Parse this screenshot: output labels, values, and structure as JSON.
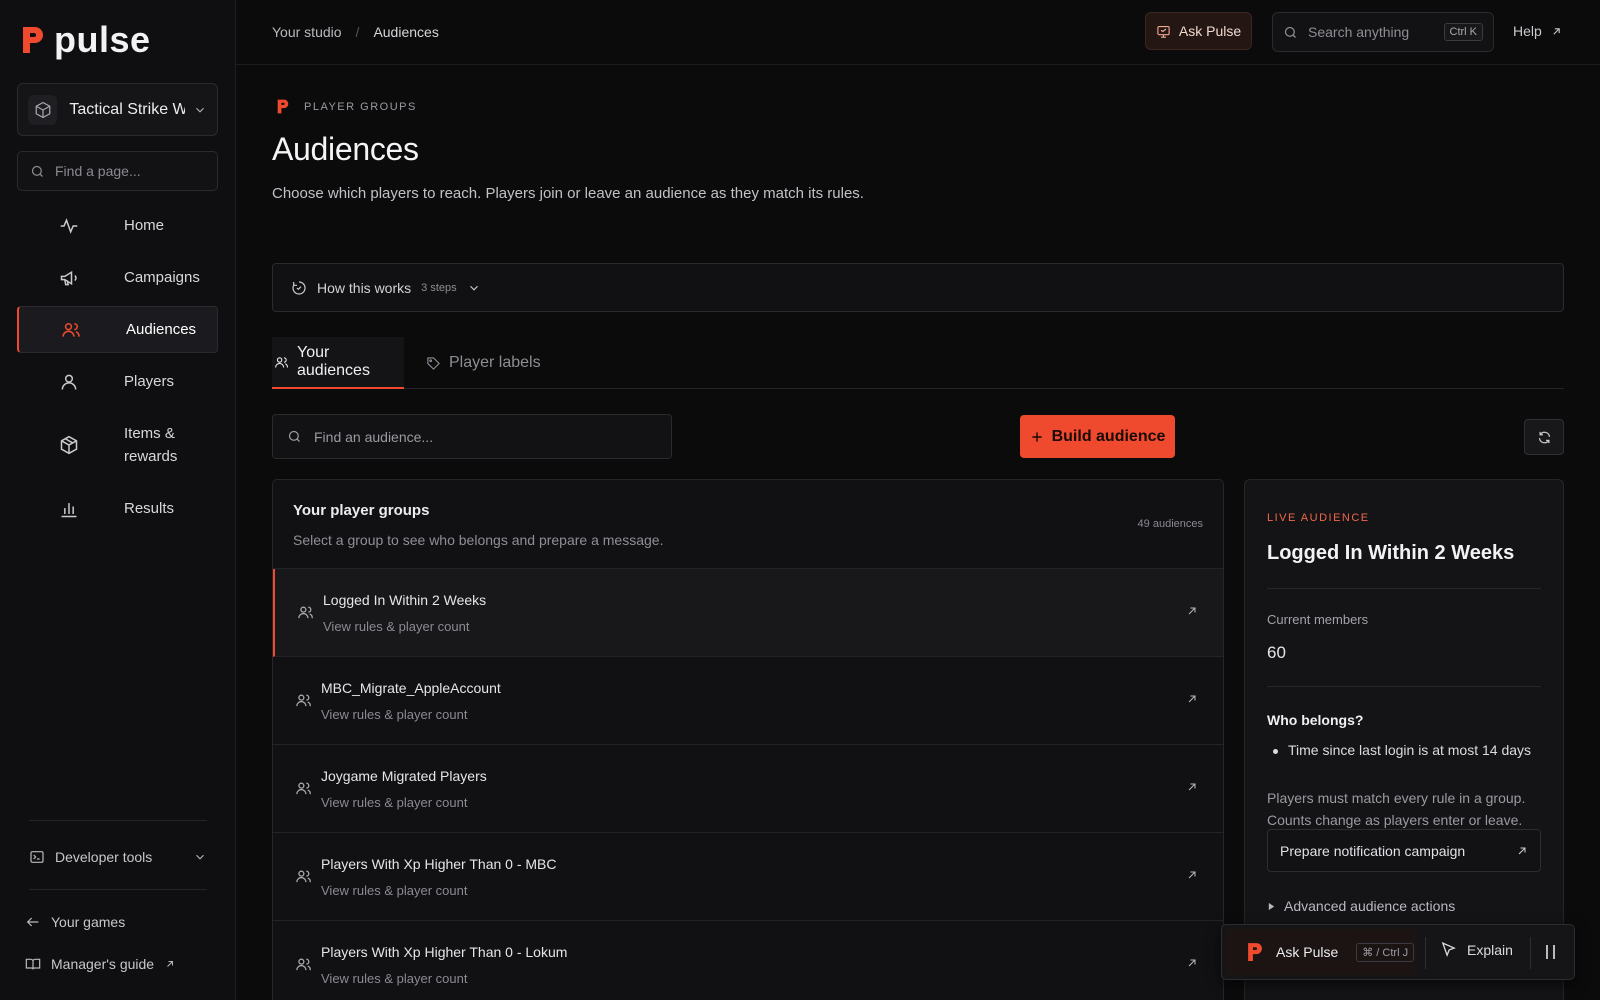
{
  "app": {
    "name": "pulse",
    "brand_color": "#f04a2e"
  },
  "sidebar": {
    "project_name": "Tactical Strike W",
    "search_placeholder": "Find a page...",
    "items": [
      {
        "label": "Home",
        "icon": "activity-icon"
      },
      {
        "label": "Campaigns",
        "icon": "megaphone-icon"
      },
      {
        "label": "Audiences",
        "icon": "users-icon",
        "active": true
      },
      {
        "label": "Players",
        "icon": "user-icon"
      },
      {
        "label": "Items & rewards",
        "icon": "box-icon"
      },
      {
        "label": "Results",
        "icon": "bar-chart-icon"
      }
    ],
    "developer_tools": "Developer tools",
    "your_games": "Your games",
    "managers_guide": "Manager's guide"
  },
  "topbar": {
    "breadcrumb": [
      "Your studio",
      "Audiences"
    ],
    "separator": "/",
    "ask_pulse": "Ask Pulse",
    "search_placeholder": "Search anything",
    "search_shortcut": "Ctrl K",
    "help": "Help"
  },
  "page": {
    "eyebrow": "PLAYER GROUPS",
    "title": "Audiences",
    "subtitle": "Choose which players to reach. Players join or leave an audience as they match its rules.",
    "how_label": "How this works",
    "how_steps": "3 steps",
    "tabs": [
      {
        "label": "Your audiences",
        "active": true
      },
      {
        "label": "Player labels",
        "active": false
      }
    ],
    "search_placeholder": "Find an audience...",
    "build_button": "Build audience"
  },
  "groups": {
    "title": "Your player groups",
    "subtitle": "Select a group to see who belongs and prepare a message.",
    "count": "49 audiences",
    "rows": [
      {
        "title": "Logged In Within 2 Weeks",
        "sub": "View rules & player count",
        "selected": true
      },
      {
        "title": "MBC_Migrate_AppleAccount",
        "sub": "View rules & player count"
      },
      {
        "title": "Joygame Migrated Players",
        "sub": "View rules & player count"
      },
      {
        "title": "Players With Xp Higher Than 0 - MBC",
        "sub": "View rules & player count"
      },
      {
        "title": "Players With Xp Higher Than 0 - Lokum",
        "sub": "View rules & player count"
      }
    ]
  },
  "detail": {
    "eyebrow": "LIVE AUDIENCE",
    "title": "Logged In Within 2 Weeks",
    "members_label": "Current members",
    "members_value": "60",
    "who_title": "Who belongs?",
    "rule": "Time since last login is at most 14 days",
    "note": "Players must match every rule in a group. Counts change as players enter or leave.",
    "prepare": "Prepare notification campaign",
    "advanced": "Advanced audience actions"
  },
  "floating": {
    "ask": "Ask Pulse",
    "shortcut": "⌘ / Ctrl J",
    "explain": "Explain"
  }
}
